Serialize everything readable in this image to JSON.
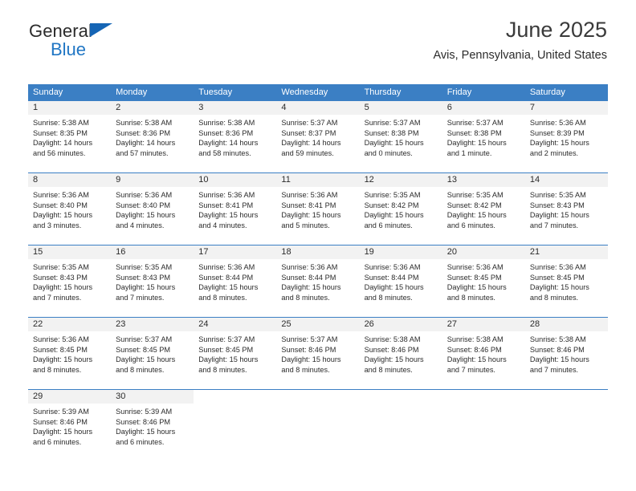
{
  "brand": {
    "line1": "General",
    "line2": "Blue",
    "triangle_icon": "brand-triangle-icon",
    "line1_color": "#2b2b2b",
    "line2_color": "#2076c4",
    "accent_color": "#1565b5"
  },
  "header": {
    "title": "June 2025",
    "location": "Avis, Pennsylvania, United States"
  },
  "theme": {
    "header_row_bg": "#3b7fc4",
    "daynum_bg": "#f2f2f2",
    "rule_color": "#3b7fc4",
    "text_color": "#2b2b2b"
  },
  "weekday_headers": [
    "Sunday",
    "Monday",
    "Tuesday",
    "Wednesday",
    "Thursday",
    "Friday",
    "Saturday"
  ],
  "weeks": [
    [
      {
        "day": "1",
        "sunrise": "Sunrise: 5:38 AM",
        "sunset": "Sunset: 8:35 PM",
        "daylight_line1": "Daylight: 14 hours",
        "daylight_line2": "and 56 minutes."
      },
      {
        "day": "2",
        "sunrise": "Sunrise: 5:38 AM",
        "sunset": "Sunset: 8:36 PM",
        "daylight_line1": "Daylight: 14 hours",
        "daylight_line2": "and 57 minutes."
      },
      {
        "day": "3",
        "sunrise": "Sunrise: 5:38 AM",
        "sunset": "Sunset: 8:36 PM",
        "daylight_line1": "Daylight: 14 hours",
        "daylight_line2": "and 58 minutes."
      },
      {
        "day": "4",
        "sunrise": "Sunrise: 5:37 AM",
        "sunset": "Sunset: 8:37 PM",
        "daylight_line1": "Daylight: 14 hours",
        "daylight_line2": "and 59 minutes."
      },
      {
        "day": "5",
        "sunrise": "Sunrise: 5:37 AM",
        "sunset": "Sunset: 8:38 PM",
        "daylight_line1": "Daylight: 15 hours",
        "daylight_line2": "and 0 minutes."
      },
      {
        "day": "6",
        "sunrise": "Sunrise: 5:37 AM",
        "sunset": "Sunset: 8:38 PM",
        "daylight_line1": "Daylight: 15 hours",
        "daylight_line2": "and 1 minute."
      },
      {
        "day": "7",
        "sunrise": "Sunrise: 5:36 AM",
        "sunset": "Sunset: 8:39 PM",
        "daylight_line1": "Daylight: 15 hours",
        "daylight_line2": "and 2 minutes."
      }
    ],
    [
      {
        "day": "8",
        "sunrise": "Sunrise: 5:36 AM",
        "sunset": "Sunset: 8:40 PM",
        "daylight_line1": "Daylight: 15 hours",
        "daylight_line2": "and 3 minutes."
      },
      {
        "day": "9",
        "sunrise": "Sunrise: 5:36 AM",
        "sunset": "Sunset: 8:40 PM",
        "daylight_line1": "Daylight: 15 hours",
        "daylight_line2": "and 4 minutes."
      },
      {
        "day": "10",
        "sunrise": "Sunrise: 5:36 AM",
        "sunset": "Sunset: 8:41 PM",
        "daylight_line1": "Daylight: 15 hours",
        "daylight_line2": "and 4 minutes."
      },
      {
        "day": "11",
        "sunrise": "Sunrise: 5:36 AM",
        "sunset": "Sunset: 8:41 PM",
        "daylight_line1": "Daylight: 15 hours",
        "daylight_line2": "and 5 minutes."
      },
      {
        "day": "12",
        "sunrise": "Sunrise: 5:35 AM",
        "sunset": "Sunset: 8:42 PM",
        "daylight_line1": "Daylight: 15 hours",
        "daylight_line2": "and 6 minutes."
      },
      {
        "day": "13",
        "sunrise": "Sunrise: 5:35 AM",
        "sunset": "Sunset: 8:42 PM",
        "daylight_line1": "Daylight: 15 hours",
        "daylight_line2": "and 6 minutes."
      },
      {
        "day": "14",
        "sunrise": "Sunrise: 5:35 AM",
        "sunset": "Sunset: 8:43 PM",
        "daylight_line1": "Daylight: 15 hours",
        "daylight_line2": "and 7 minutes."
      }
    ],
    [
      {
        "day": "15",
        "sunrise": "Sunrise: 5:35 AM",
        "sunset": "Sunset: 8:43 PM",
        "daylight_line1": "Daylight: 15 hours",
        "daylight_line2": "and 7 minutes."
      },
      {
        "day": "16",
        "sunrise": "Sunrise: 5:35 AM",
        "sunset": "Sunset: 8:43 PM",
        "daylight_line1": "Daylight: 15 hours",
        "daylight_line2": "and 7 minutes."
      },
      {
        "day": "17",
        "sunrise": "Sunrise: 5:36 AM",
        "sunset": "Sunset: 8:44 PM",
        "daylight_line1": "Daylight: 15 hours",
        "daylight_line2": "and 8 minutes."
      },
      {
        "day": "18",
        "sunrise": "Sunrise: 5:36 AM",
        "sunset": "Sunset: 8:44 PM",
        "daylight_line1": "Daylight: 15 hours",
        "daylight_line2": "and 8 minutes."
      },
      {
        "day": "19",
        "sunrise": "Sunrise: 5:36 AM",
        "sunset": "Sunset: 8:44 PM",
        "daylight_line1": "Daylight: 15 hours",
        "daylight_line2": "and 8 minutes."
      },
      {
        "day": "20",
        "sunrise": "Sunrise: 5:36 AM",
        "sunset": "Sunset: 8:45 PM",
        "daylight_line1": "Daylight: 15 hours",
        "daylight_line2": "and 8 minutes."
      },
      {
        "day": "21",
        "sunrise": "Sunrise: 5:36 AM",
        "sunset": "Sunset: 8:45 PM",
        "daylight_line1": "Daylight: 15 hours",
        "daylight_line2": "and 8 minutes."
      }
    ],
    [
      {
        "day": "22",
        "sunrise": "Sunrise: 5:36 AM",
        "sunset": "Sunset: 8:45 PM",
        "daylight_line1": "Daylight: 15 hours",
        "daylight_line2": "and 8 minutes."
      },
      {
        "day": "23",
        "sunrise": "Sunrise: 5:37 AM",
        "sunset": "Sunset: 8:45 PM",
        "daylight_line1": "Daylight: 15 hours",
        "daylight_line2": "and 8 minutes."
      },
      {
        "day": "24",
        "sunrise": "Sunrise: 5:37 AM",
        "sunset": "Sunset: 8:45 PM",
        "daylight_line1": "Daylight: 15 hours",
        "daylight_line2": "and 8 minutes."
      },
      {
        "day": "25",
        "sunrise": "Sunrise: 5:37 AM",
        "sunset": "Sunset: 8:46 PM",
        "daylight_line1": "Daylight: 15 hours",
        "daylight_line2": "and 8 minutes."
      },
      {
        "day": "26",
        "sunrise": "Sunrise: 5:38 AM",
        "sunset": "Sunset: 8:46 PM",
        "daylight_line1": "Daylight: 15 hours",
        "daylight_line2": "and 8 minutes."
      },
      {
        "day": "27",
        "sunrise": "Sunrise: 5:38 AM",
        "sunset": "Sunset: 8:46 PM",
        "daylight_line1": "Daylight: 15 hours",
        "daylight_line2": "and 7 minutes."
      },
      {
        "day": "28",
        "sunrise": "Sunrise: 5:38 AM",
        "sunset": "Sunset: 8:46 PM",
        "daylight_line1": "Daylight: 15 hours",
        "daylight_line2": "and 7 minutes."
      }
    ],
    [
      {
        "day": "29",
        "sunrise": "Sunrise: 5:39 AM",
        "sunset": "Sunset: 8:46 PM",
        "daylight_line1": "Daylight: 15 hours",
        "daylight_line2": "and 6 minutes."
      },
      {
        "day": "30",
        "sunrise": "Sunrise: 5:39 AM",
        "sunset": "Sunset: 8:46 PM",
        "daylight_line1": "Daylight: 15 hours",
        "daylight_line2": "and 6 minutes."
      },
      null,
      null,
      null,
      null,
      null
    ]
  ]
}
